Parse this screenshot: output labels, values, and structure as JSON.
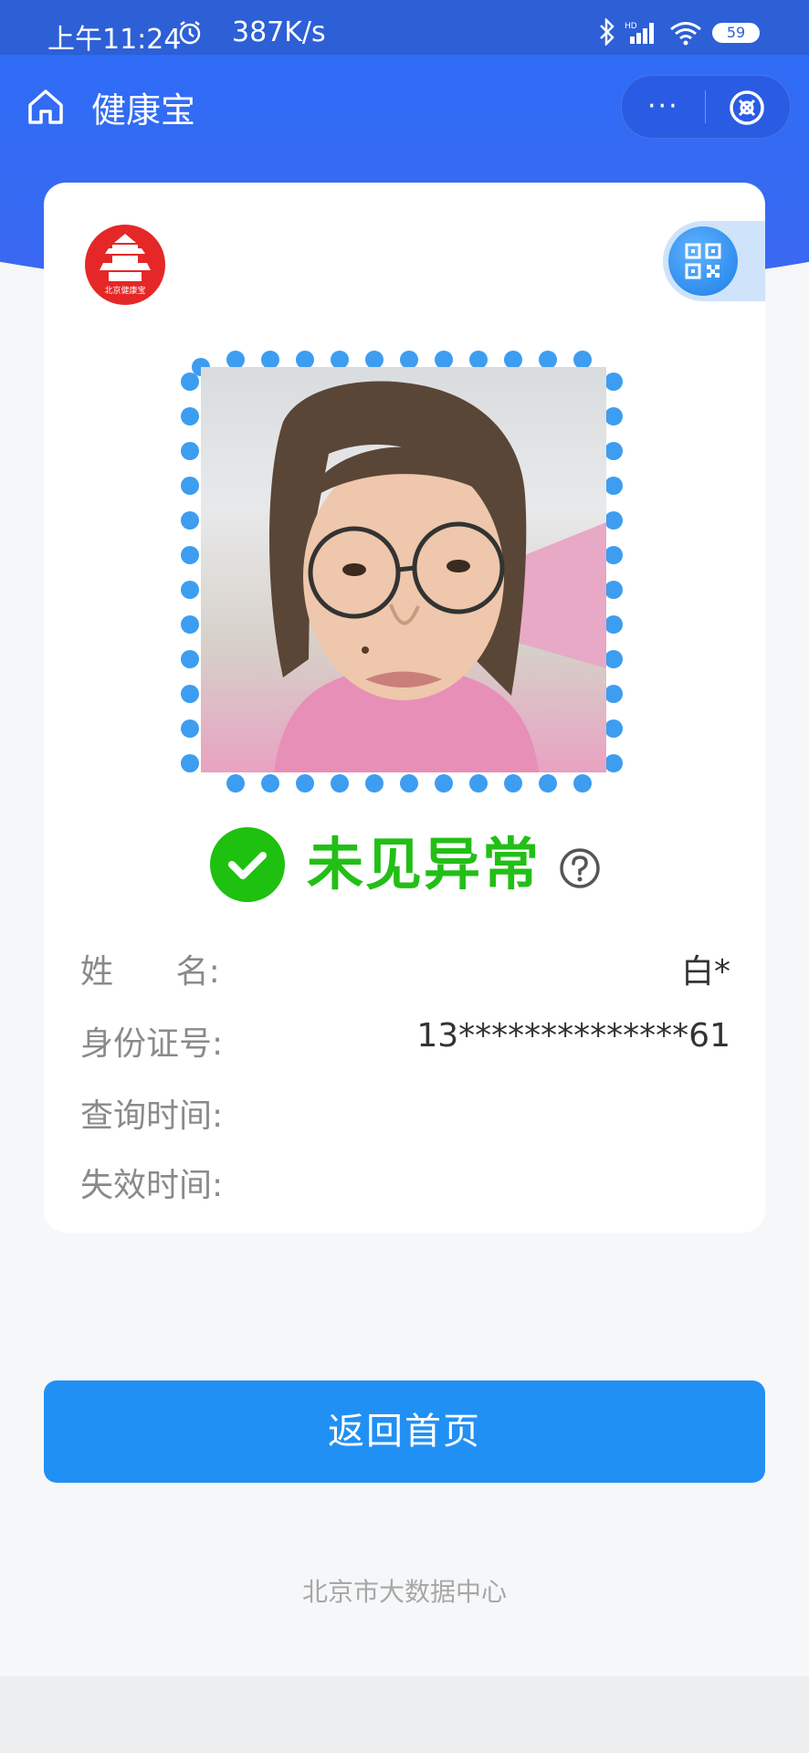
{
  "status_bar": {
    "time": "上午11:24",
    "speed": "387K/s",
    "battery": "59",
    "icons": [
      "alarm-icon",
      "bluetooth-icon",
      "hd-signal-icon",
      "wifi-icon",
      "battery-icon"
    ]
  },
  "nav": {
    "title": "健康宝",
    "more_label": "···",
    "icons": [
      "home-icon",
      "more-icon",
      "close-target-icon"
    ]
  },
  "card": {
    "logo_text": "北京健康宝",
    "status": "未见异常",
    "status_color": "#22bf16",
    "rows": [
      {
        "label": "姓      名:",
        "value": "白*"
      },
      {
        "label": "身份证号:",
        "value": "13**************61"
      },
      {
        "label": "查询时间:",
        "value": ""
      },
      {
        "label": "失效时间:",
        "value": ""
      }
    ]
  },
  "actions": {
    "home_button": "返回首页"
  },
  "footer": {
    "text": "北京市大数据中心"
  },
  "colors": {
    "header_blue": "#2f6cf6",
    "button_blue": "#2190f4",
    "frame_dot_blue": "#3d9df0",
    "logo_red": "#e52727"
  }
}
